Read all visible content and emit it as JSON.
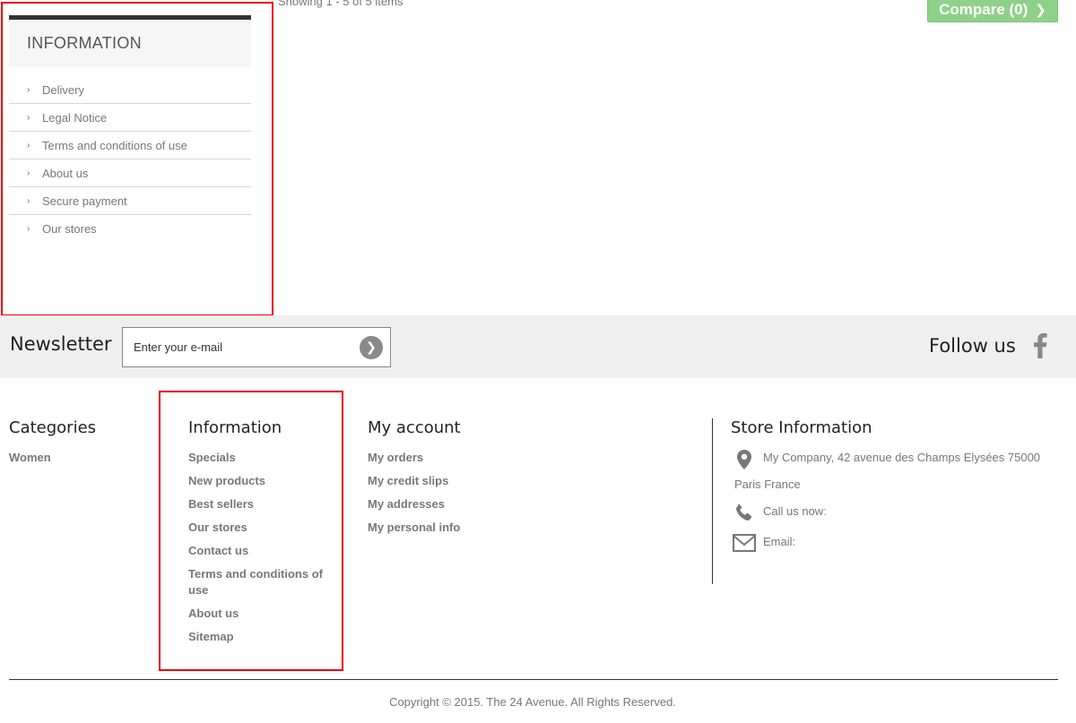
{
  "listing": {
    "showing_text": "Showing 1 - 5 of 5 items",
    "compare_label": "Compare (0)"
  },
  "info_block": {
    "title": "INFORMATION",
    "items": [
      {
        "label": "Delivery"
      },
      {
        "label": "Legal Notice"
      },
      {
        "label": "Terms and conditions of use"
      },
      {
        "label": "About us"
      },
      {
        "label": "Secure payment"
      },
      {
        "label": "Our stores"
      }
    ]
  },
  "newsletter": {
    "title": "Newsletter",
    "placeholder": "Enter your e-mail",
    "follow_title": "Follow us",
    "social_icon": "facebook-icon"
  },
  "footer": {
    "categories": {
      "title": "Categories",
      "items": [
        "Women"
      ]
    },
    "information": {
      "title": "Information",
      "items": [
        "Specials",
        "New products",
        "Best sellers",
        "Our stores",
        "Contact us",
        "Terms and conditions of use",
        "About us",
        "Sitemap"
      ]
    },
    "account": {
      "title": "My account",
      "items": [
        "My orders",
        "My credit slips",
        "My addresses",
        "My personal info"
      ]
    },
    "store": {
      "title": "Store Information",
      "address_line1": "My Company, 42 avenue des Champs Elysées 75000",
      "address_line2": "Paris France",
      "call_label": "Call us now:",
      "email_label": "Email:"
    },
    "copyright": "Copyright © 2015. The 24 Avenue. All Rights Reserved."
  },
  "colors": {
    "highlight": "#e8000d",
    "compare_button": "#8fd08b",
    "newsletter_bg": "#efefef",
    "link_grey": "#777777"
  }
}
